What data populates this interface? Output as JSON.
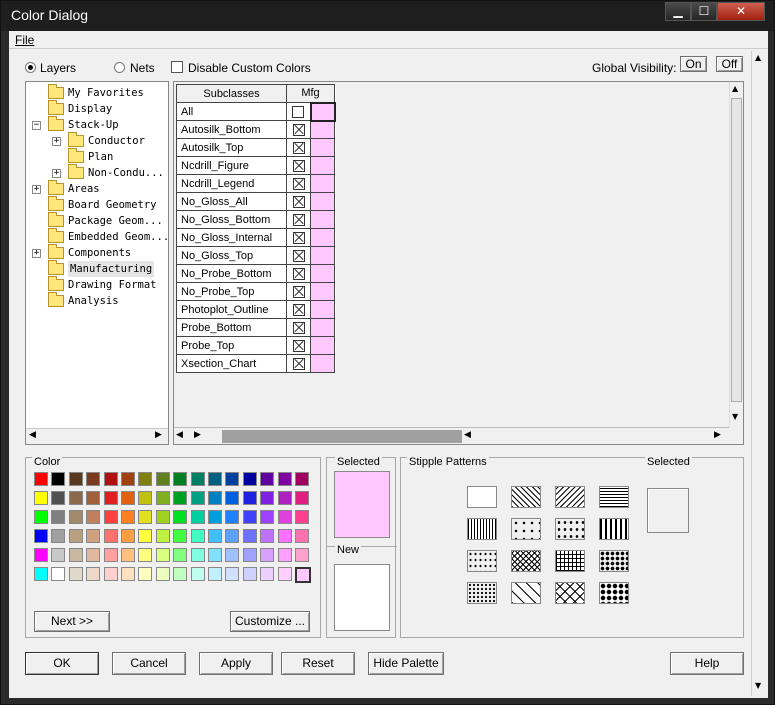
{
  "window": {
    "title": "Color Dialog"
  },
  "menu": {
    "file": "File"
  },
  "top": {
    "layers": "Layers",
    "nets": "Nets",
    "disable_custom": "Disable Custom Colors",
    "global_visibility": "Global Visibility:",
    "on": "On",
    "off": "Off"
  },
  "tree": [
    {
      "label": "My Favorites",
      "indent": 1,
      "expander": "none"
    },
    {
      "label": "Display",
      "indent": 1,
      "expander": "none"
    },
    {
      "label": "Stack-Up",
      "indent": 1,
      "expander": "minus"
    },
    {
      "label": "Conductor",
      "indent": 2,
      "expander": "plus"
    },
    {
      "label": "Plan",
      "indent": 2,
      "expander": "none"
    },
    {
      "label": "Non-Condu...",
      "indent": 2,
      "expander": "plus"
    },
    {
      "label": "Areas",
      "indent": 1,
      "expander": "plus"
    },
    {
      "label": "Board Geometry",
      "indent": 1,
      "expander": "none"
    },
    {
      "label": "Package Geom...",
      "indent": 1,
      "expander": "none"
    },
    {
      "label": "Embedded Geom...",
      "indent": 1,
      "expander": "none"
    },
    {
      "label": "Components",
      "indent": 1,
      "expander": "plus"
    },
    {
      "label": "Manufacturing",
      "indent": 1,
      "expander": "none",
      "selected": true
    },
    {
      "label": "Drawing Format",
      "indent": 1,
      "expander": "none"
    },
    {
      "label": "Analysis",
      "indent": 1,
      "expander": "none"
    }
  ],
  "grid": {
    "col_subclasses": "Subclasses",
    "col_mfg": "Mfg",
    "rows": [
      {
        "name": "All",
        "checked": false
      },
      {
        "name": "Autosilk_Bottom",
        "checked": true
      },
      {
        "name": "Autosilk_Top",
        "checked": true
      },
      {
        "name": "Ncdrill_Figure",
        "checked": true
      },
      {
        "name": "Ncdrill_Legend",
        "checked": true
      },
      {
        "name": "No_Gloss_All",
        "checked": true
      },
      {
        "name": "No_Gloss_Bottom",
        "checked": true
      },
      {
        "name": "No_Gloss_Internal",
        "checked": true
      },
      {
        "name": "No_Gloss_Top",
        "checked": true
      },
      {
        "name": "No_Probe_Bottom",
        "checked": true
      },
      {
        "name": "No_Probe_Top",
        "checked": true
      },
      {
        "name": "Photoplot_Outline",
        "checked": true
      },
      {
        "name": "Probe_Bottom",
        "checked": true
      },
      {
        "name": "Probe_Top",
        "checked": true
      },
      {
        "name": "Xsection_Chart",
        "checked": true
      }
    ]
  },
  "color_panel": {
    "label": "Color",
    "next": "Next >>",
    "customize": "Customize ...",
    "palette": [
      [
        "#ff0000",
        "#000000",
        "#5a3a1e",
        "#7a3a1e",
        "#b01010",
        "#a04010",
        "#808010",
        "#608020",
        "#008020",
        "#008060",
        "#006080",
        "#0040a0",
        "#0000a0",
        "#6000a0",
        "#8000a0",
        "#a00060"
      ],
      [
        "#ffff00",
        "#505050",
        "#8a6a4a",
        "#a0603a",
        "#e02020",
        "#e06010",
        "#c0c010",
        "#80b020",
        "#00a020",
        "#00a080",
        "#0080c0",
        "#0060e0",
        "#2020e0",
        "#8020e0",
        "#b020c0",
        "#e02080"
      ],
      [
        "#00ff00",
        "#808080",
        "#a08a6a",
        "#c08060",
        "#ff4040",
        "#ff8020",
        "#e0e020",
        "#a0d020",
        "#00e020",
        "#00d0a0",
        "#00a0e0",
        "#2080ff",
        "#4040ff",
        "#a040ff",
        "#e040e0",
        "#ff4090"
      ],
      [
        "#0000ff",
        "#a0a0a0",
        "#b8a080",
        "#d0a080",
        "#ff7070",
        "#ffa040",
        "#ffff40",
        "#c0f040",
        "#40ff40",
        "#40ffc0",
        "#40c0ff",
        "#60a0ff",
        "#7070ff",
        "#c070ff",
        "#ff70ff",
        "#ff70b0"
      ],
      [
        "#ff00ff",
        "#c8c8c8",
        "#c8b8a0",
        "#e0b8a0",
        "#ffa0a0",
        "#ffc080",
        "#ffff80",
        "#d8ff80",
        "#80ff80",
        "#80ffe0",
        "#80e0ff",
        "#a0c0ff",
        "#a0a0ff",
        "#d8a0ff",
        "#ffa0ff",
        "#ffa0d0"
      ],
      [
        "#00ffff",
        "#ffffff",
        "#e0d8c8",
        "#f0d8c8",
        "#ffd0d0",
        "#ffe0c0",
        "#ffffc0",
        "#ecffc0",
        "#c0ffc0",
        "#c0fff0",
        "#c0f0ff",
        "#d0e0ff",
        "#d0d0ff",
        "#ecd0ff",
        "#ffd0ff",
        "#ffc8ff"
      ]
    ]
  },
  "selected_panel": {
    "label": "Selected",
    "new_label": "New",
    "selected_color": "#ffc8ff",
    "new_color": "#ffffff"
  },
  "stipple": {
    "label": "Stipple Patterns",
    "selected_label": "Selected"
  },
  "buttons": {
    "ok": "OK",
    "cancel": "Cancel",
    "apply": "Apply",
    "reset": "Reset",
    "hide_palette": "Hide Palette",
    "help": "Help"
  }
}
